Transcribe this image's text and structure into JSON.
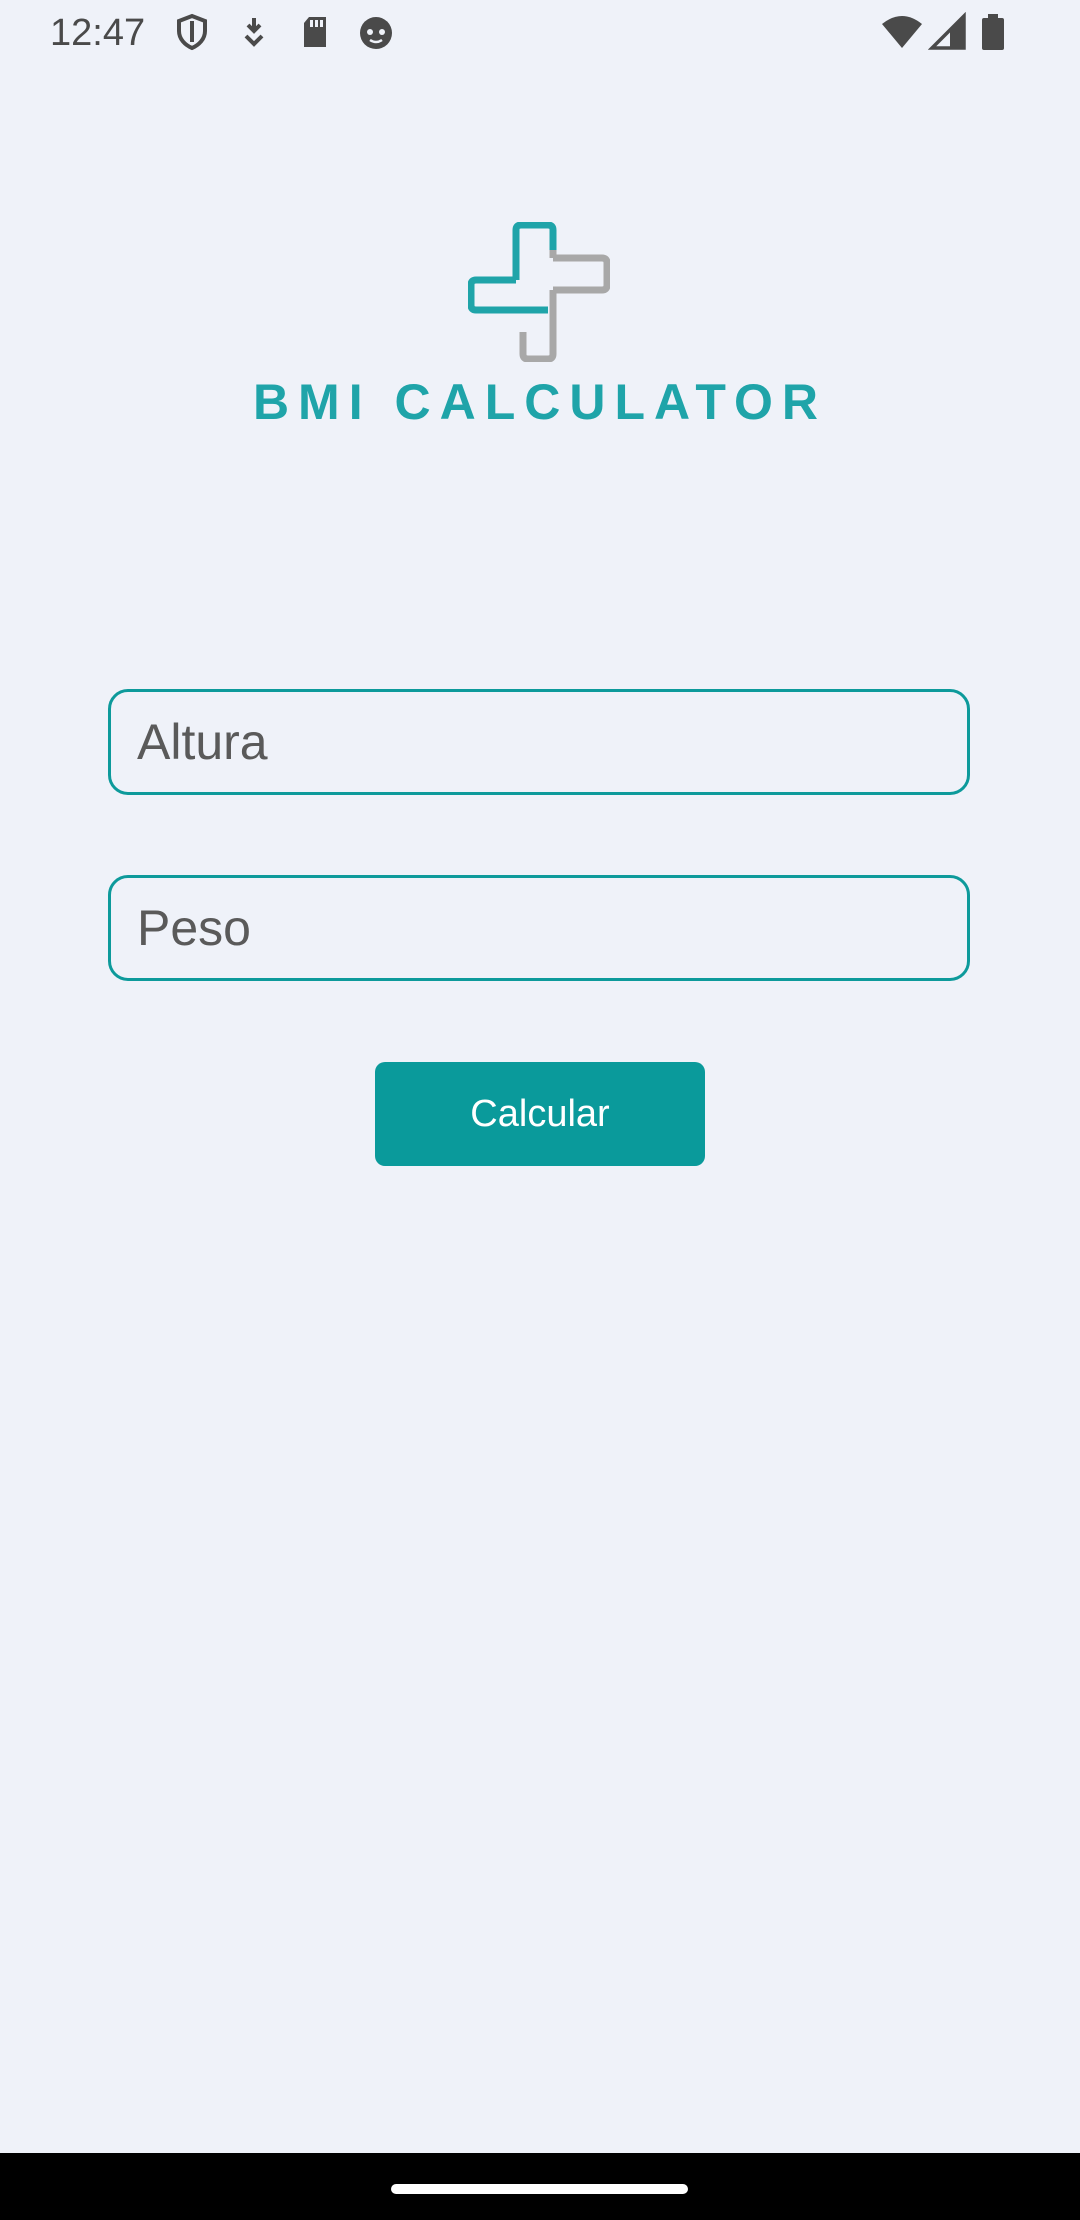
{
  "status_bar": {
    "time": "12:47",
    "left_icons": [
      "shield-icon",
      "download-icon",
      "sd-card-icon",
      "face-icon"
    ],
    "right_icons": [
      "wifi-icon",
      "cell-signal-icon",
      "battery-icon"
    ]
  },
  "logo": {
    "text": "BMI CALCULATOR",
    "primary_color": "#1fa4a9",
    "secondary_color": "#a8a8a8"
  },
  "form": {
    "height_placeholder": "Altura",
    "weight_placeholder": "Peso",
    "calculate_label": "Calcular"
  },
  "colors": {
    "background": "#eff2f9",
    "accent": "#0a9a9b",
    "field_border": "#0d9a9b"
  }
}
